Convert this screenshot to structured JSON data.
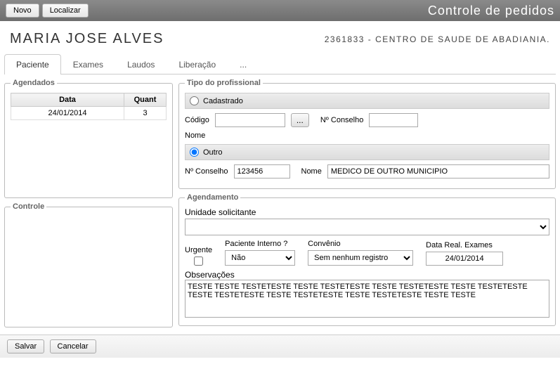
{
  "toolbar": {
    "novo": "Novo",
    "localizar": "Localizar",
    "title": "Controle de pedidos"
  },
  "header": {
    "patient": "MARIA JOSE ALVES",
    "location": "2361833 - CENTRO DE SAUDE DE ABADIANIA."
  },
  "tabs": {
    "paciente": "Paciente",
    "exames": "Exames",
    "laudos": "Laudos",
    "liberacao": "Liberação",
    "more": "..."
  },
  "agendados": {
    "legend": "Agendados",
    "col_data": "Data",
    "col_quant": "Quant",
    "rows": [
      {
        "data": "24/01/2014",
        "quant": "3"
      }
    ]
  },
  "controle": {
    "legend": "Controle"
  },
  "tipo": {
    "legend": "Tipo do profissional",
    "cadastrado": "Cadastrado",
    "codigo": "Código",
    "codigo_val": "",
    "lookup": "...",
    "nconselho": "Nº Conselho",
    "nconselho_cad_val": "",
    "nome": "Nome",
    "outro": "Outro",
    "nconselho_outro_val": "123456",
    "nome_outro_val": "MEDICO DE OUTRO MUNICIPIO"
  },
  "agendamento": {
    "legend": "Agendamento",
    "unidade_label": "Unidade solicitante",
    "unidade_val": "",
    "urgente": "Urgente",
    "paciente_interno": "Paciente Interno ?",
    "paciente_interno_val": "Não",
    "convenio": "Convênio",
    "convenio_val": "Sem nenhum registro",
    "data_real": "Data Real. Exames",
    "data_real_val": "24/01/2014",
    "obs_label": "Observações",
    "obs_val": "TESTE TESTE TESTETESTE TESTE TESTETESTE TESTE TESTETESTE TESTE TESTETESTE TESTE TESTETESTE TESTE TESTETESTE TESTE TESTETESTE TESTE TESTE"
  },
  "footer": {
    "salvar": "Salvar",
    "cancelar": "Cancelar"
  }
}
